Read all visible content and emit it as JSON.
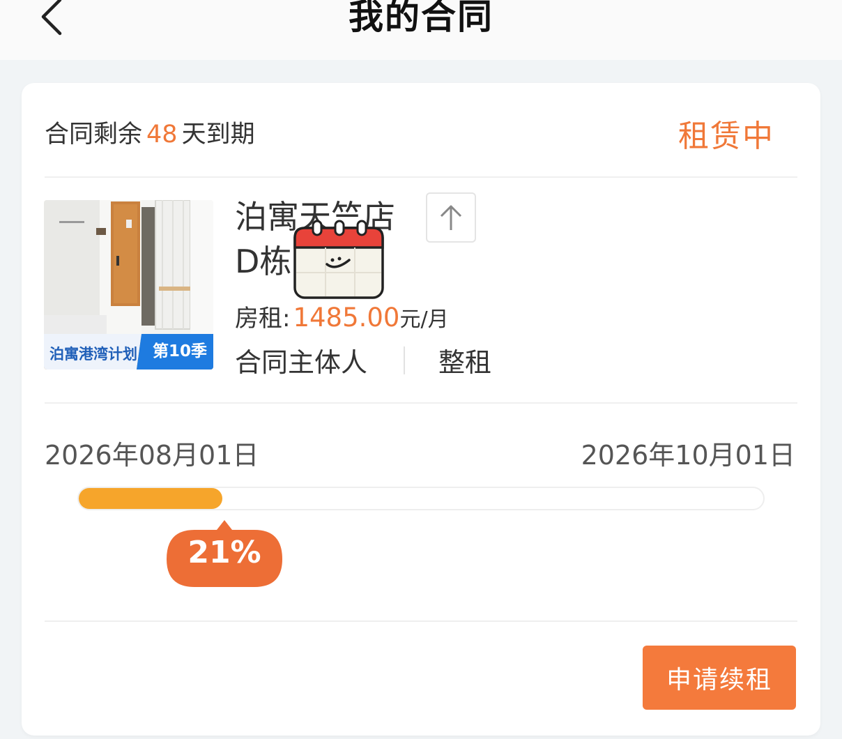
{
  "header": {
    "title": "我的合同",
    "back_icon": "chevron-left-icon"
  },
  "contract": {
    "remain_prefix": "合同剩余",
    "remain_days": "48",
    "remain_suffix": "天到期",
    "status": "租赁中",
    "thumbnail": {
      "campaign_label": "泊寓港湾计划",
      "season_label": "第10季"
    },
    "room_name": "泊寓天竺店 D栋",
    "share_icon": "share-up-arrow-icon",
    "rent_label": "房租:",
    "rent_price": "1485.00",
    "rent_unit": "元/月",
    "role": "合同主体人",
    "rent_type": "整租",
    "start_date": "2026年08月01日",
    "end_date": "2026年10月01日",
    "progress_percent": 21,
    "progress_label": "21%",
    "renew_button": "申请续租"
  },
  "colors": {
    "accent": "#f07838",
    "progress": "#f6a52b",
    "button": "#f47a3c"
  }
}
